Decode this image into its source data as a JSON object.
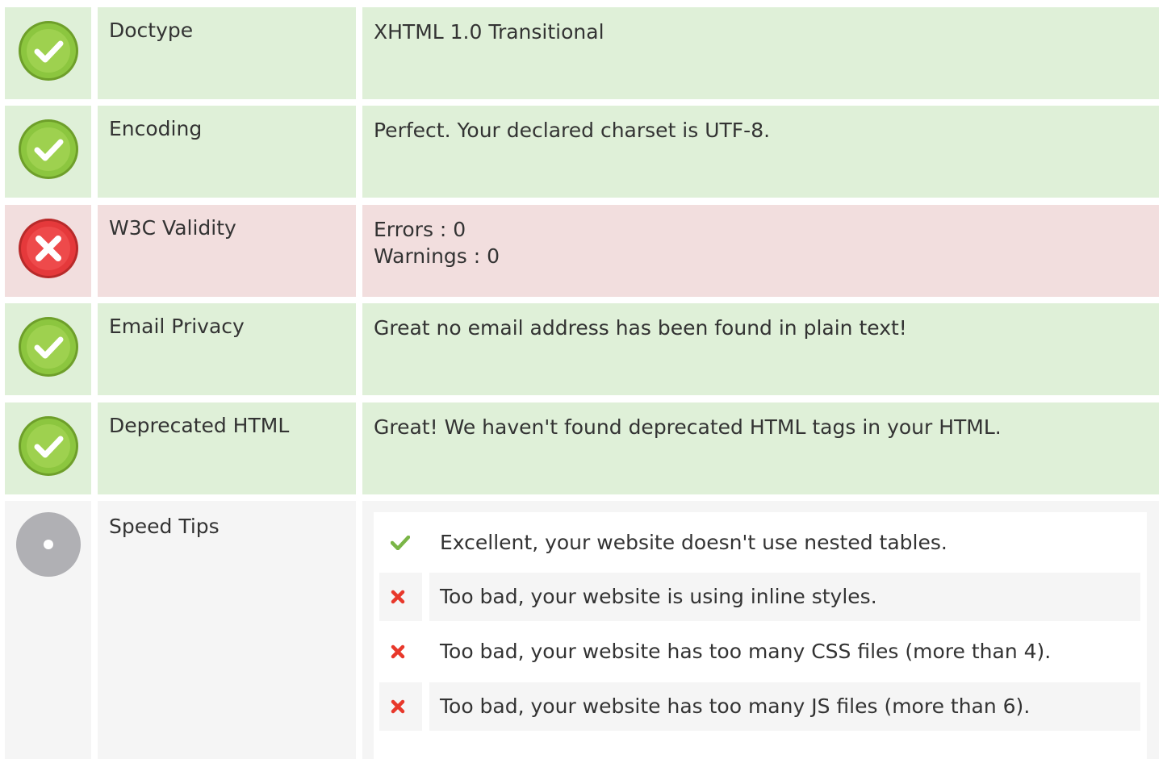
{
  "rows": [
    {
      "label": "Doctype",
      "status": "pass",
      "lines": [
        "XHTML 1.0 Transitional"
      ]
    },
    {
      "label": "Encoding",
      "status": "pass",
      "lines": [
        "Perfect. Your declared charset is UTF-8."
      ]
    },
    {
      "label": "W3C Validity",
      "status": "fail",
      "lines": [
        "Errors : 0",
        "Warnings : 0"
      ]
    },
    {
      "label": "Email Privacy",
      "status": "pass",
      "lines": [
        "Great no email address has been found in plain text!"
      ]
    },
    {
      "label": "Deprecated HTML",
      "status": "pass",
      "lines": [
        "Great! We haven't found deprecated HTML tags in your HTML."
      ]
    }
  ],
  "speed_tips": {
    "label": "Speed Tips",
    "status": "neutral",
    "items": [
      {
        "status": "pass",
        "text": "Excellent, your website doesn't use nested tables."
      },
      {
        "status": "fail",
        "text": "Too bad, your website is using inline styles."
      },
      {
        "status": "fail",
        "text": "Too bad, your website has too many CSS files (more than 4)."
      },
      {
        "status": "fail",
        "text": "Too bad, your website has too many JS files (more than 6)."
      }
    ]
  },
  "colors": {
    "pass_bg": "#dff0d8",
    "fail_bg": "#f2dede",
    "neutral_bg": "#f5f5f5",
    "pass_icon": "#8cc63f",
    "fail_icon": "#e5393b",
    "neutral_icon": "#b0b0b4",
    "tip_pass": "#7ab547",
    "tip_fail": "#e8382b"
  },
  "icons": {
    "pass": "check-circle-icon",
    "fail": "x-circle-icon",
    "neutral": "neutral-circle-icon",
    "tip_pass": "checkmark-icon",
    "tip_fail": "x-mark-icon"
  }
}
